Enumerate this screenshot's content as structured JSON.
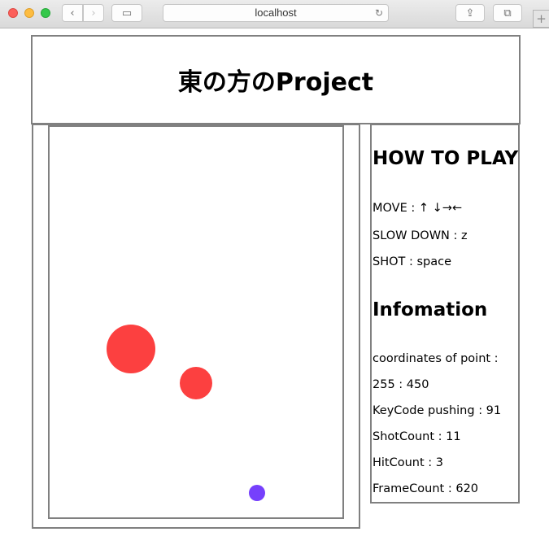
{
  "browser": {
    "url": "localhost",
    "back_glyph": "‹",
    "forward_glyph": "›",
    "sidebar_glyph": "▭",
    "share_glyph": "⇪",
    "tabs_glyph": "⧉",
    "reload_glyph": "↻",
    "newtab_glyph": "+"
  },
  "header": {
    "title": "東の方のProject"
  },
  "game": {
    "balls": [
      {
        "role": "enemy-large",
        "color": "#fc4040"
      },
      {
        "role": "enemy-small",
        "color": "#fc4040"
      },
      {
        "role": "player",
        "color": "#7640fc"
      }
    ]
  },
  "howto": {
    "title": "HOW TO PLAY",
    "move": "MOVE : ↑ ↓→←",
    "slow": "SLOW DOWN : z",
    "shot": "SHOT : space"
  },
  "info": {
    "title": "Infomation",
    "coords_label": "coordinates of point :",
    "coords_value": "255 : 450",
    "keycode": "KeyCode pushing : 91",
    "shotcount": "ShotCount : 11",
    "hitcount": "HitCount : 3",
    "framecount": "FrameCount : 620"
  }
}
